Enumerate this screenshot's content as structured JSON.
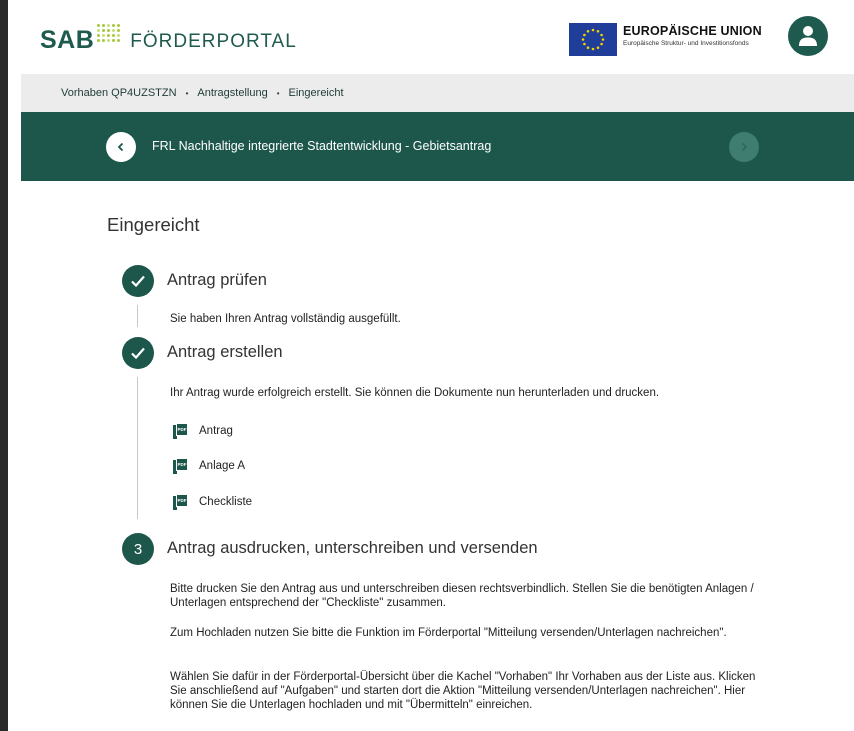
{
  "header": {
    "logo_sab": "SAB",
    "logo_portal": "FÖRDERPORTAL",
    "eu_title": "EUROPÄISCHE UNION",
    "eu_subtitle": "Europäische Struktur- und Investitionsfonds",
    "avatar_icon": "user-icon"
  },
  "breadcrumb": {
    "items": [
      "Vorhaben QP4UZSTZN",
      "Antragstellung",
      "Eingereicht"
    ],
    "separator": "•"
  },
  "titlebar": {
    "title": "FRL Nachhaltige integrierte Stadtentwicklung - Gebietsantrag",
    "back_icon": "chevron-left-icon",
    "next_icon": "chevron-right-icon"
  },
  "main": {
    "section_title": "Eingereicht",
    "steps": [
      {
        "status": "done",
        "heading": "Antrag prüfen",
        "text": "Sie haben Ihren Antrag vollständig ausgefüllt."
      },
      {
        "status": "done",
        "heading": "Antrag erstellen",
        "text": "Ihr Antrag wurde erfolgreich erstellt. Sie können die Dokumente nun herunterladen und drucken.",
        "documents": [
          "Antrag",
          "Anlage A",
          "Checkliste"
        ]
      },
      {
        "status": "open",
        "number": "3",
        "heading": "Antrag ausdrucken, unterschreiben und versenden",
        "paragraphs": [
          "Bitte drucken Sie den Antrag aus und unterschreiben diesen rechtsverbindlich. Stellen Sie die benötigten Anlagen / Unterlagen entsprechend der \"Checkliste\" zusammen.",
          "Zum Hochladen nutzen Sie bitte die Funktion im Förderportal \"Mitteilung versenden/Unterlagen nachreichen\".",
          "Wählen Sie dafür in der Förderportal-Übersicht über die Kachel \"Vorhaben\" Ihr Vorhaben aus der Liste aus. Klicken Sie anschließend auf \"Aufgaben\" und starten dort die Aktion \"Mitteilung versenden/Unterlagen nachreichen\". Hier können Sie die Unterlagen hochladen und mit \"Übermitteln\" einreichen."
        ]
      }
    ],
    "pdf_icon_label": "PDF"
  },
  "colors": {
    "brand": "#1d574c",
    "accent": "#a6c93c",
    "breadcrumb_bg": "#ececec",
    "eu_blue": "#1f3d99"
  }
}
